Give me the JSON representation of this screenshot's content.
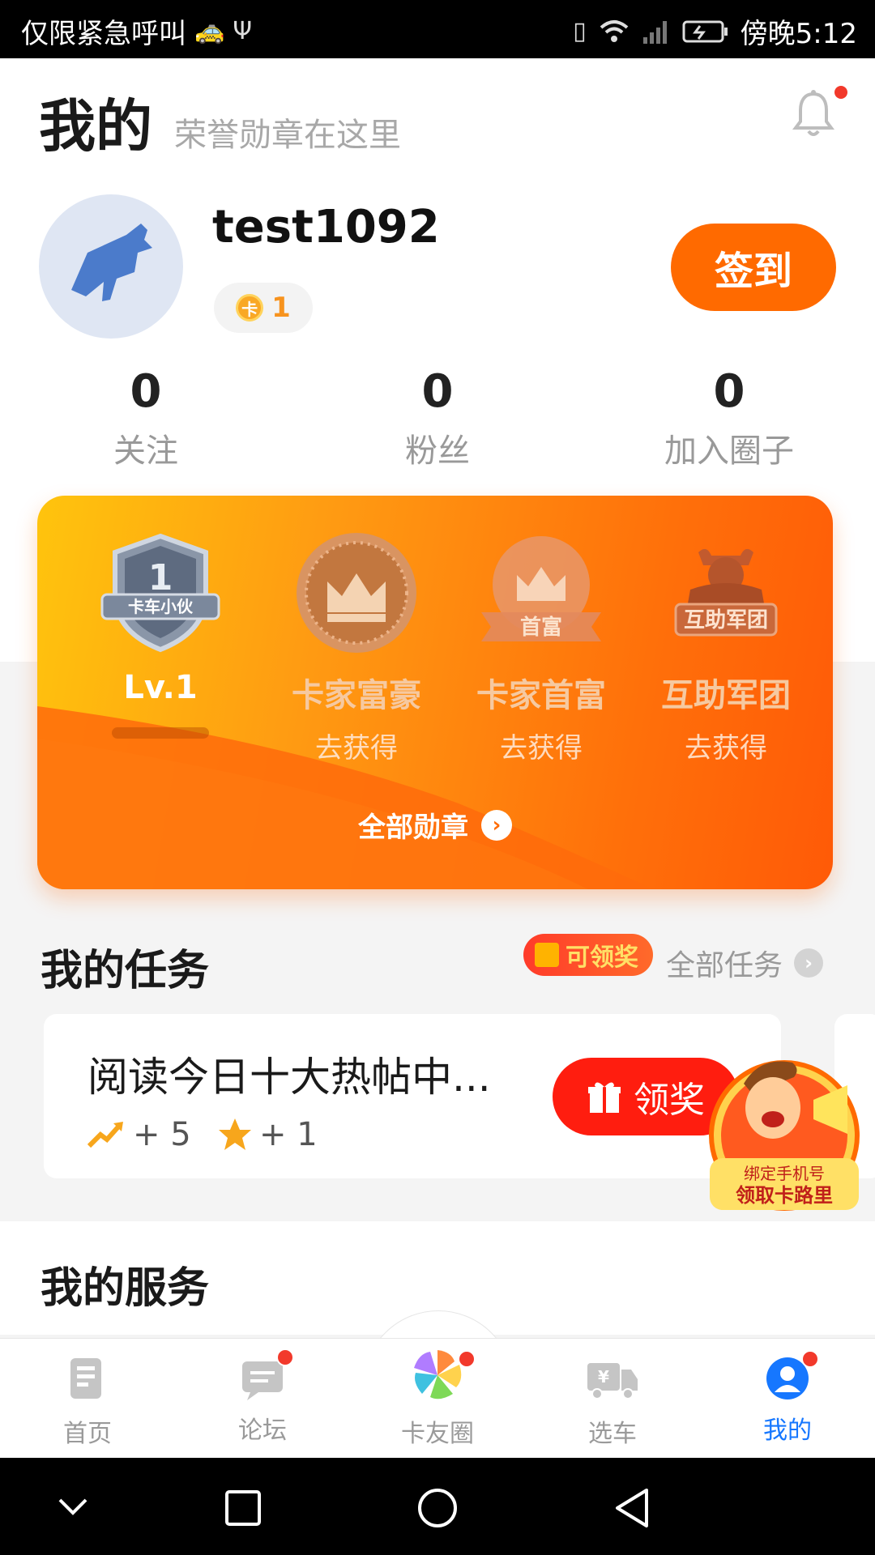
{
  "status_bar": {
    "left_text": "仅限紧急呼叫",
    "time": "傍晚5:12"
  },
  "header": {
    "title": "我的",
    "subtitle": "荣誉勋章在这里"
  },
  "profile": {
    "username": "test1092",
    "coin_symbol": "卡",
    "coin_count": "1",
    "signin_label": "签到"
  },
  "stats": [
    {
      "value": "0",
      "label": "关注"
    },
    {
      "value": "0",
      "label": "粉丝"
    },
    {
      "value": "0",
      "label": "加入圈子"
    }
  ],
  "medals": {
    "items": [
      {
        "name": "Lv.1",
        "sub": "",
        "badge_text": "卡车小伙",
        "badge_num": "1"
      },
      {
        "name": "卡家富豪",
        "sub": "去获得"
      },
      {
        "name": "卡家首富",
        "sub": "去获得",
        "badge_text": "首富"
      },
      {
        "name": "互助军团",
        "sub": "去获得",
        "badge_text": "互助军团"
      }
    ],
    "all_label": "全部勋章"
  },
  "tasks": {
    "title": "我的任务",
    "reward_tag": "可领奖",
    "all_label": "全部任务",
    "card": {
      "title": "阅读今日十大热帖中...",
      "reward1": "+ 5",
      "reward2": "+ 1",
      "claim_label": "领奖"
    },
    "promo": {
      "line1": "绑定手机号",
      "line2": "领取卡路里"
    }
  },
  "services": {
    "title": "我的服务"
  },
  "tabbar": [
    {
      "label": "首页",
      "icon": "home-doc-icon"
    },
    {
      "label": "论坛",
      "icon": "forum-chat-icon"
    },
    {
      "label": "卡友圈",
      "icon": "pinwheel-icon"
    },
    {
      "label": "选车",
      "icon": "truck-icon"
    },
    {
      "label": "我的",
      "icon": "profile-icon"
    }
  ],
  "colors": {
    "accent": "#ff6a00",
    "active_tab": "#1677ff",
    "badge_red": "#f2392b"
  }
}
